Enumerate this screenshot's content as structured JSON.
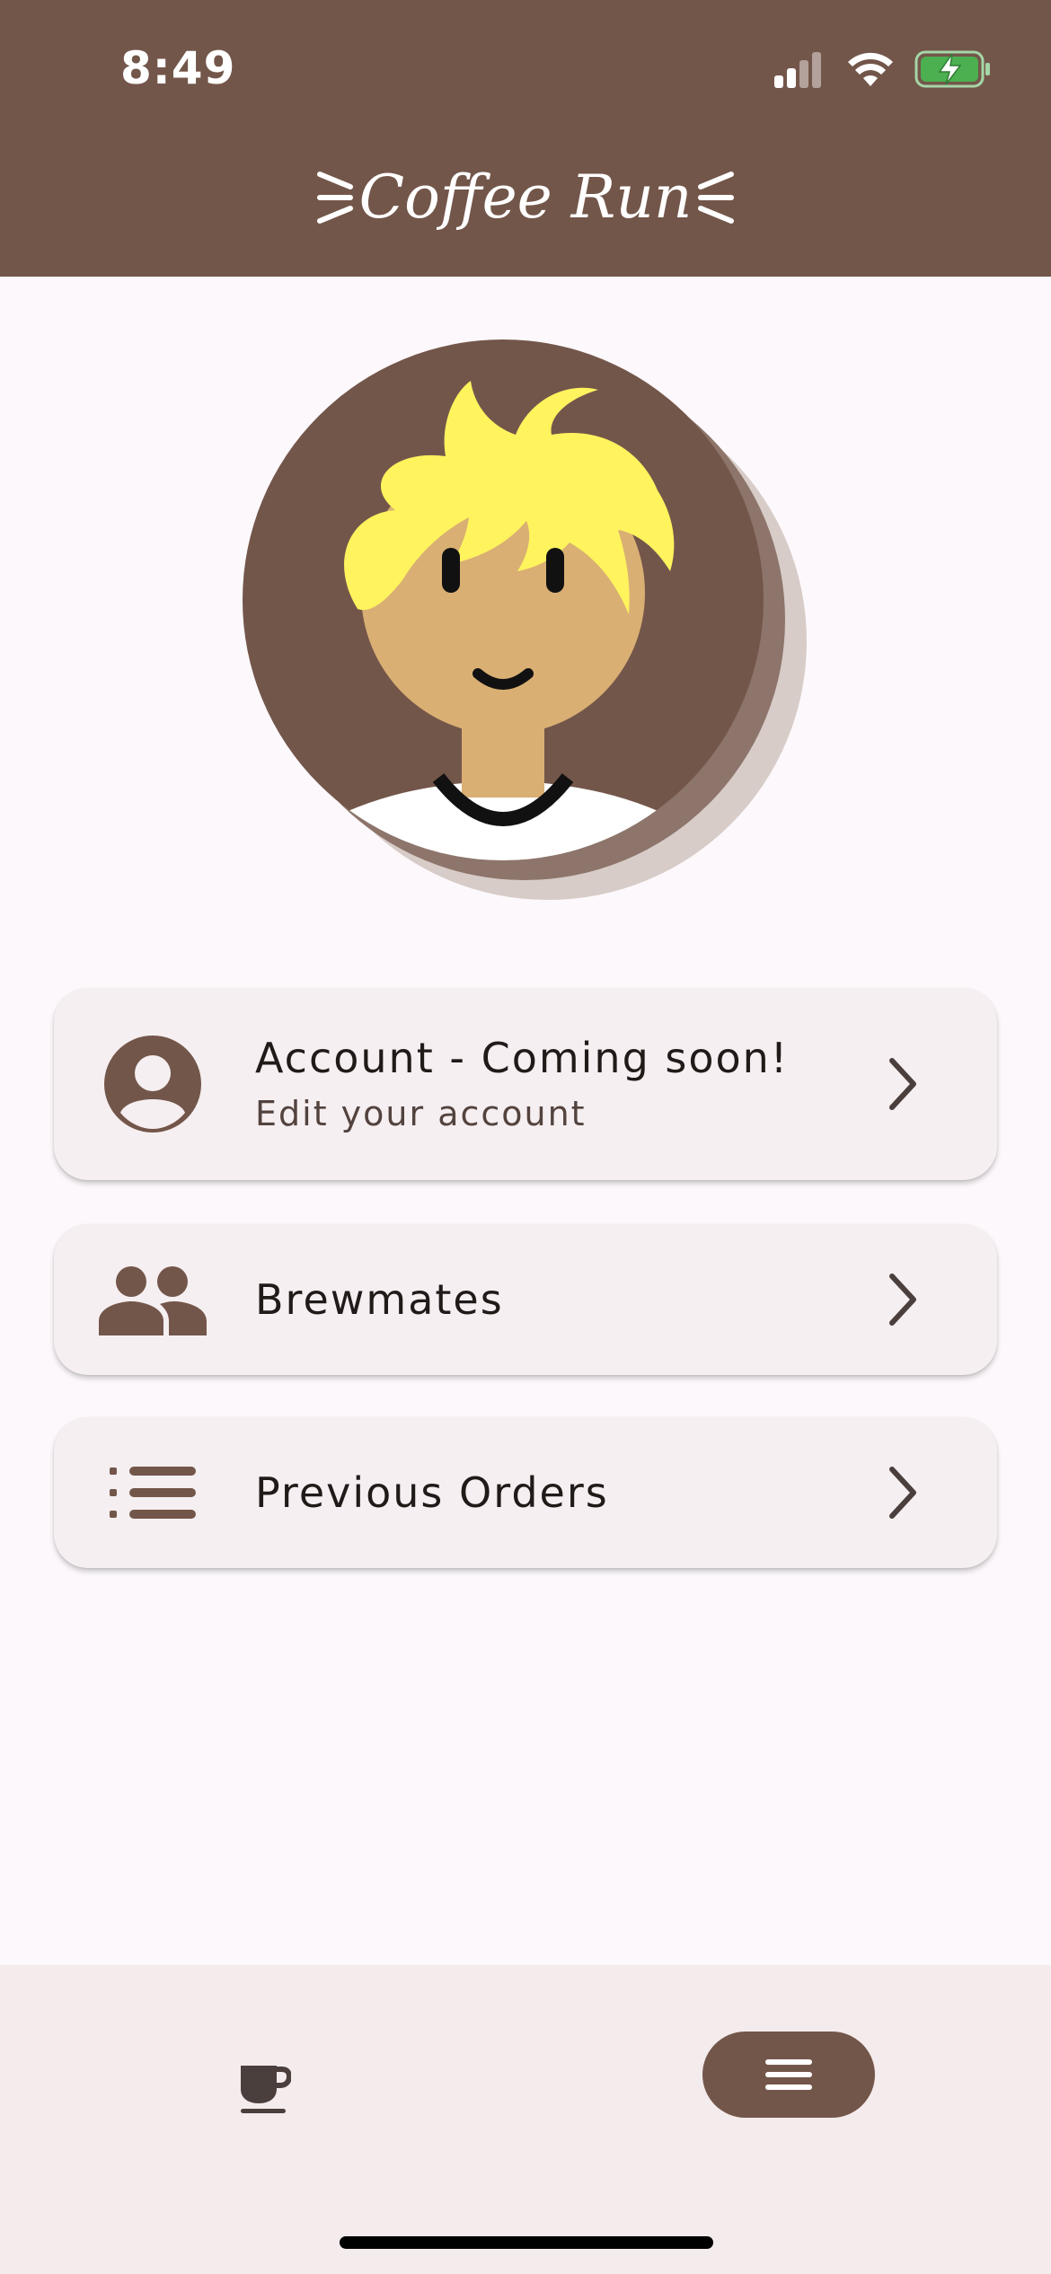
{
  "status_bar": {
    "time": "8:49",
    "icons": [
      "cellular-signal-icon",
      "wifi-icon",
      "battery-charging-icon"
    ]
  },
  "header": {
    "title": "Coffee Run"
  },
  "profile": {
    "avatar": "user-avatar-illustration"
  },
  "menu": {
    "items": [
      {
        "title": "Account - Coming soon!",
        "subtitle": "Edit your account",
        "icon": "account-circle-icon"
      },
      {
        "title": "Brewmates",
        "icon": "people-icon"
      },
      {
        "title": "Previous Orders",
        "icon": "list-icon"
      }
    ]
  },
  "bottom_nav": {
    "items": [
      {
        "icon": "coffee-cup-icon",
        "selected": false
      },
      {
        "icon": "hamburger-menu-icon",
        "selected": true
      }
    ]
  },
  "colors": {
    "brand": "#73564A",
    "background": "#FCF8FB",
    "card": "#F6EFF1",
    "nav_background": "#F4EBEC",
    "text": "#201A19",
    "hair": "#FFF35E",
    "skin": "#D9AF73"
  }
}
